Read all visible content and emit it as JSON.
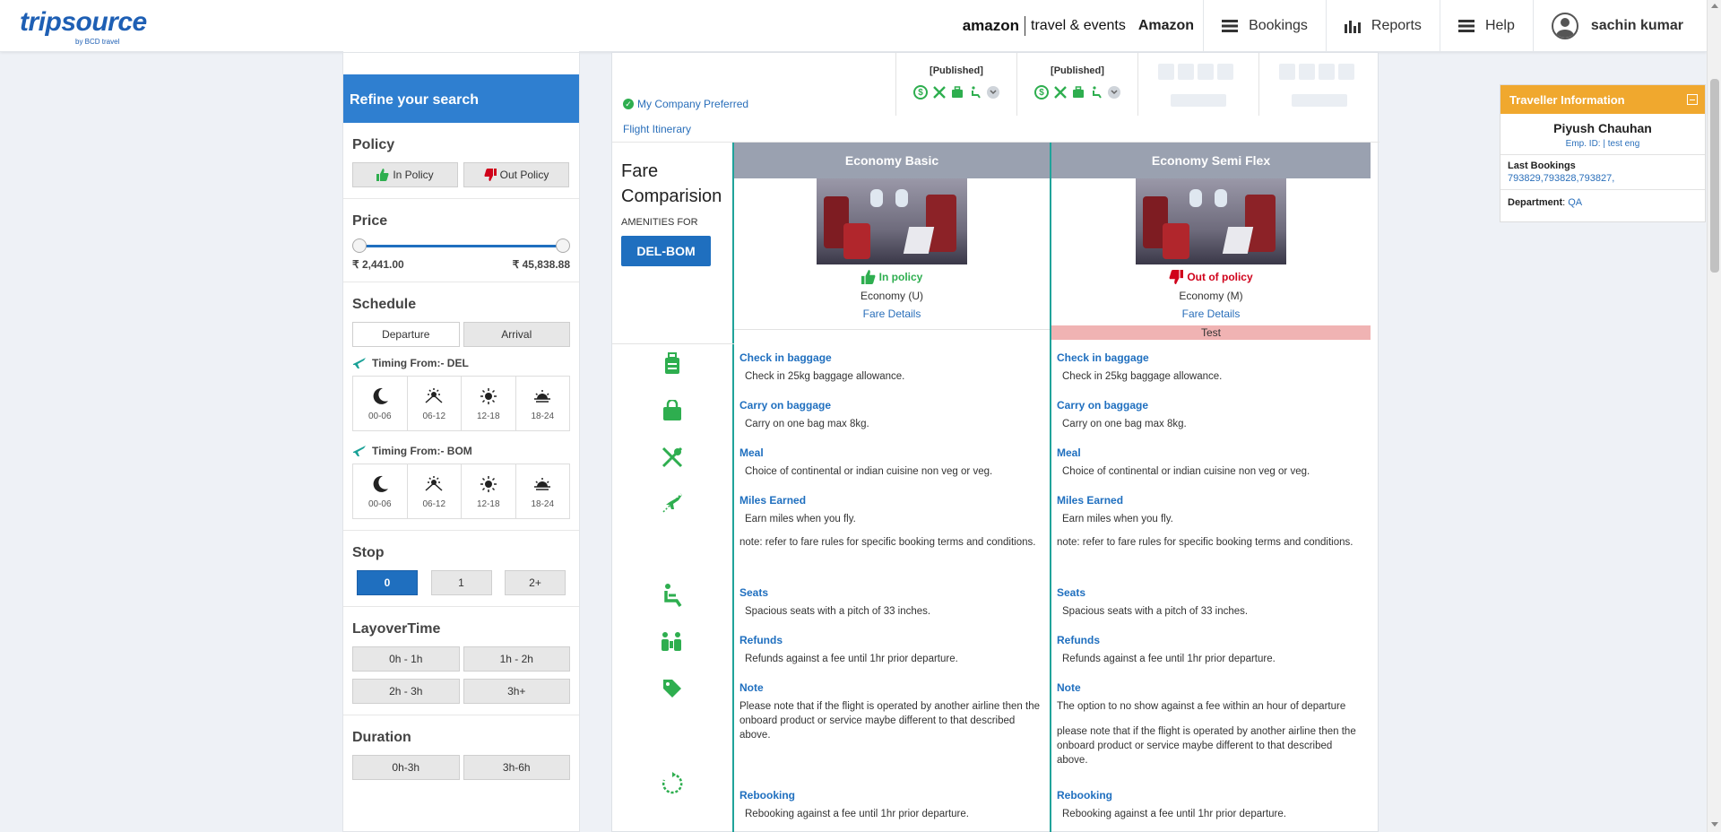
{
  "header": {
    "logo_text": "tripsource",
    "logo_sub": "by BCD travel",
    "amazon_logo": "amazon",
    "amazon_tag": "travel & events",
    "company": "Amazon",
    "nav": [
      {
        "label": "Bookings",
        "icon": "list-icon"
      },
      {
        "label": "Reports",
        "icon": "bar-chart-icon"
      },
      {
        "label": "Help",
        "icon": "list-icon"
      }
    ],
    "user": "sachin kumar"
  },
  "sidebar": {
    "title": "Refine your search",
    "policy": {
      "heading": "Policy",
      "in": "In Policy",
      "out": "Out Policy"
    },
    "price": {
      "heading": "Price",
      "min": "₹ 2,441.00",
      "max": "₹ 45,838.88"
    },
    "schedule": {
      "heading": "Schedule",
      "tabs": [
        "Departure",
        "Arrival"
      ],
      "timing_del": "Timing From:- DEL",
      "timing_bom": "Timing From:- BOM",
      "slots": [
        "00-06",
        "06-12",
        "12-18",
        "18-24"
      ]
    },
    "stop": {
      "heading": "Stop",
      "options": [
        "0",
        "1",
        "2+"
      ]
    },
    "layover": {
      "heading": "LayoverTime",
      "options": [
        "0h - 1h",
        "1h - 2h",
        "2h - 3h",
        "3h+"
      ]
    },
    "duration": {
      "heading": "Duration",
      "options": [
        "0h-3h",
        "3h-6h"
      ]
    }
  },
  "flight": {
    "preferred": "My Company Preferred",
    "itinerary": "Flight Itinerary",
    "published_1": "[Published]",
    "published_2": "[Published]"
  },
  "fare": {
    "title_line1": "Fare",
    "title_line2": "Comparision",
    "amenities_for": "AMENITIES FOR",
    "route": "DEL-BOM",
    "columns": [
      {
        "name": "Economy Basic",
        "status": "In policy",
        "class": "Economy (U)",
        "details": "Fare Details",
        "tag": "",
        "amenities": [
          {
            "title": "Check in baggage",
            "desc": "Check in 25kg baggage allowance."
          },
          {
            "title": "Carry on baggage",
            "desc": "Carry on one bag max 8kg."
          },
          {
            "title": "Meal",
            "desc": "Choice of continental or indian cuisine non veg or veg."
          },
          {
            "title": "Miles Earned",
            "desc": "Earn miles when you fly.",
            "note": "note: refer to fare rules for specific booking terms and conditions."
          },
          {
            "title": "Seats",
            "desc": "Spacious seats with a pitch of 33 inches."
          },
          {
            "title": "Refunds",
            "desc": "Refunds against a fee until 1hr prior departure."
          },
          {
            "title": "Note",
            "desc": "Please note that if the flight is operated by another airline then the onboard product or service maybe different to that described above."
          },
          {
            "title": "Rebooking",
            "desc": "Rebooking against a fee until 1hr prior departure."
          }
        ]
      },
      {
        "name": "Economy Semi Flex",
        "status": "Out of policy",
        "class": "Economy (M)",
        "details": "Fare Details",
        "tag": "Test",
        "amenities": [
          {
            "title": "Check in baggage",
            "desc": "Check in 25kg baggage allowance."
          },
          {
            "title": "Carry on baggage",
            "desc": "Carry on one bag max 8kg."
          },
          {
            "title": "Meal",
            "desc": "Choice of continental or indian cuisine non veg or veg."
          },
          {
            "title": "Miles Earned",
            "desc": "Earn miles when you fly.",
            "note": "note: refer to fare rules for specific booking terms and conditions."
          },
          {
            "title": "Seats",
            "desc": "Spacious seats with a pitch of 33 inches."
          },
          {
            "title": "Refunds",
            "desc": "Refunds against a fee until 1hr prior departure."
          },
          {
            "title": "Note",
            "desc": "The option to no show against a fee within an hour of departure",
            "note": "please note that if the flight is operated by another airline then the onboard product or service maybe different to that described above."
          },
          {
            "title": "Rebooking",
            "desc": "Rebooking against a fee until 1hr prior departure."
          }
        ]
      }
    ]
  },
  "traveller": {
    "heading": "Traveller Information",
    "name": "Piyush Chauhan",
    "emp": "Emp. ID: | test eng",
    "last_label": "Last Bookings",
    "last_values": "793829,793828,793827,",
    "dept_label": "Department",
    "dept_value": "QA"
  },
  "colors": {
    "accent": "#1f6fbf",
    "teal": "#20a39a",
    "green": "#2eae4f",
    "orange": "#f0a82e",
    "red": "#d0021b"
  }
}
